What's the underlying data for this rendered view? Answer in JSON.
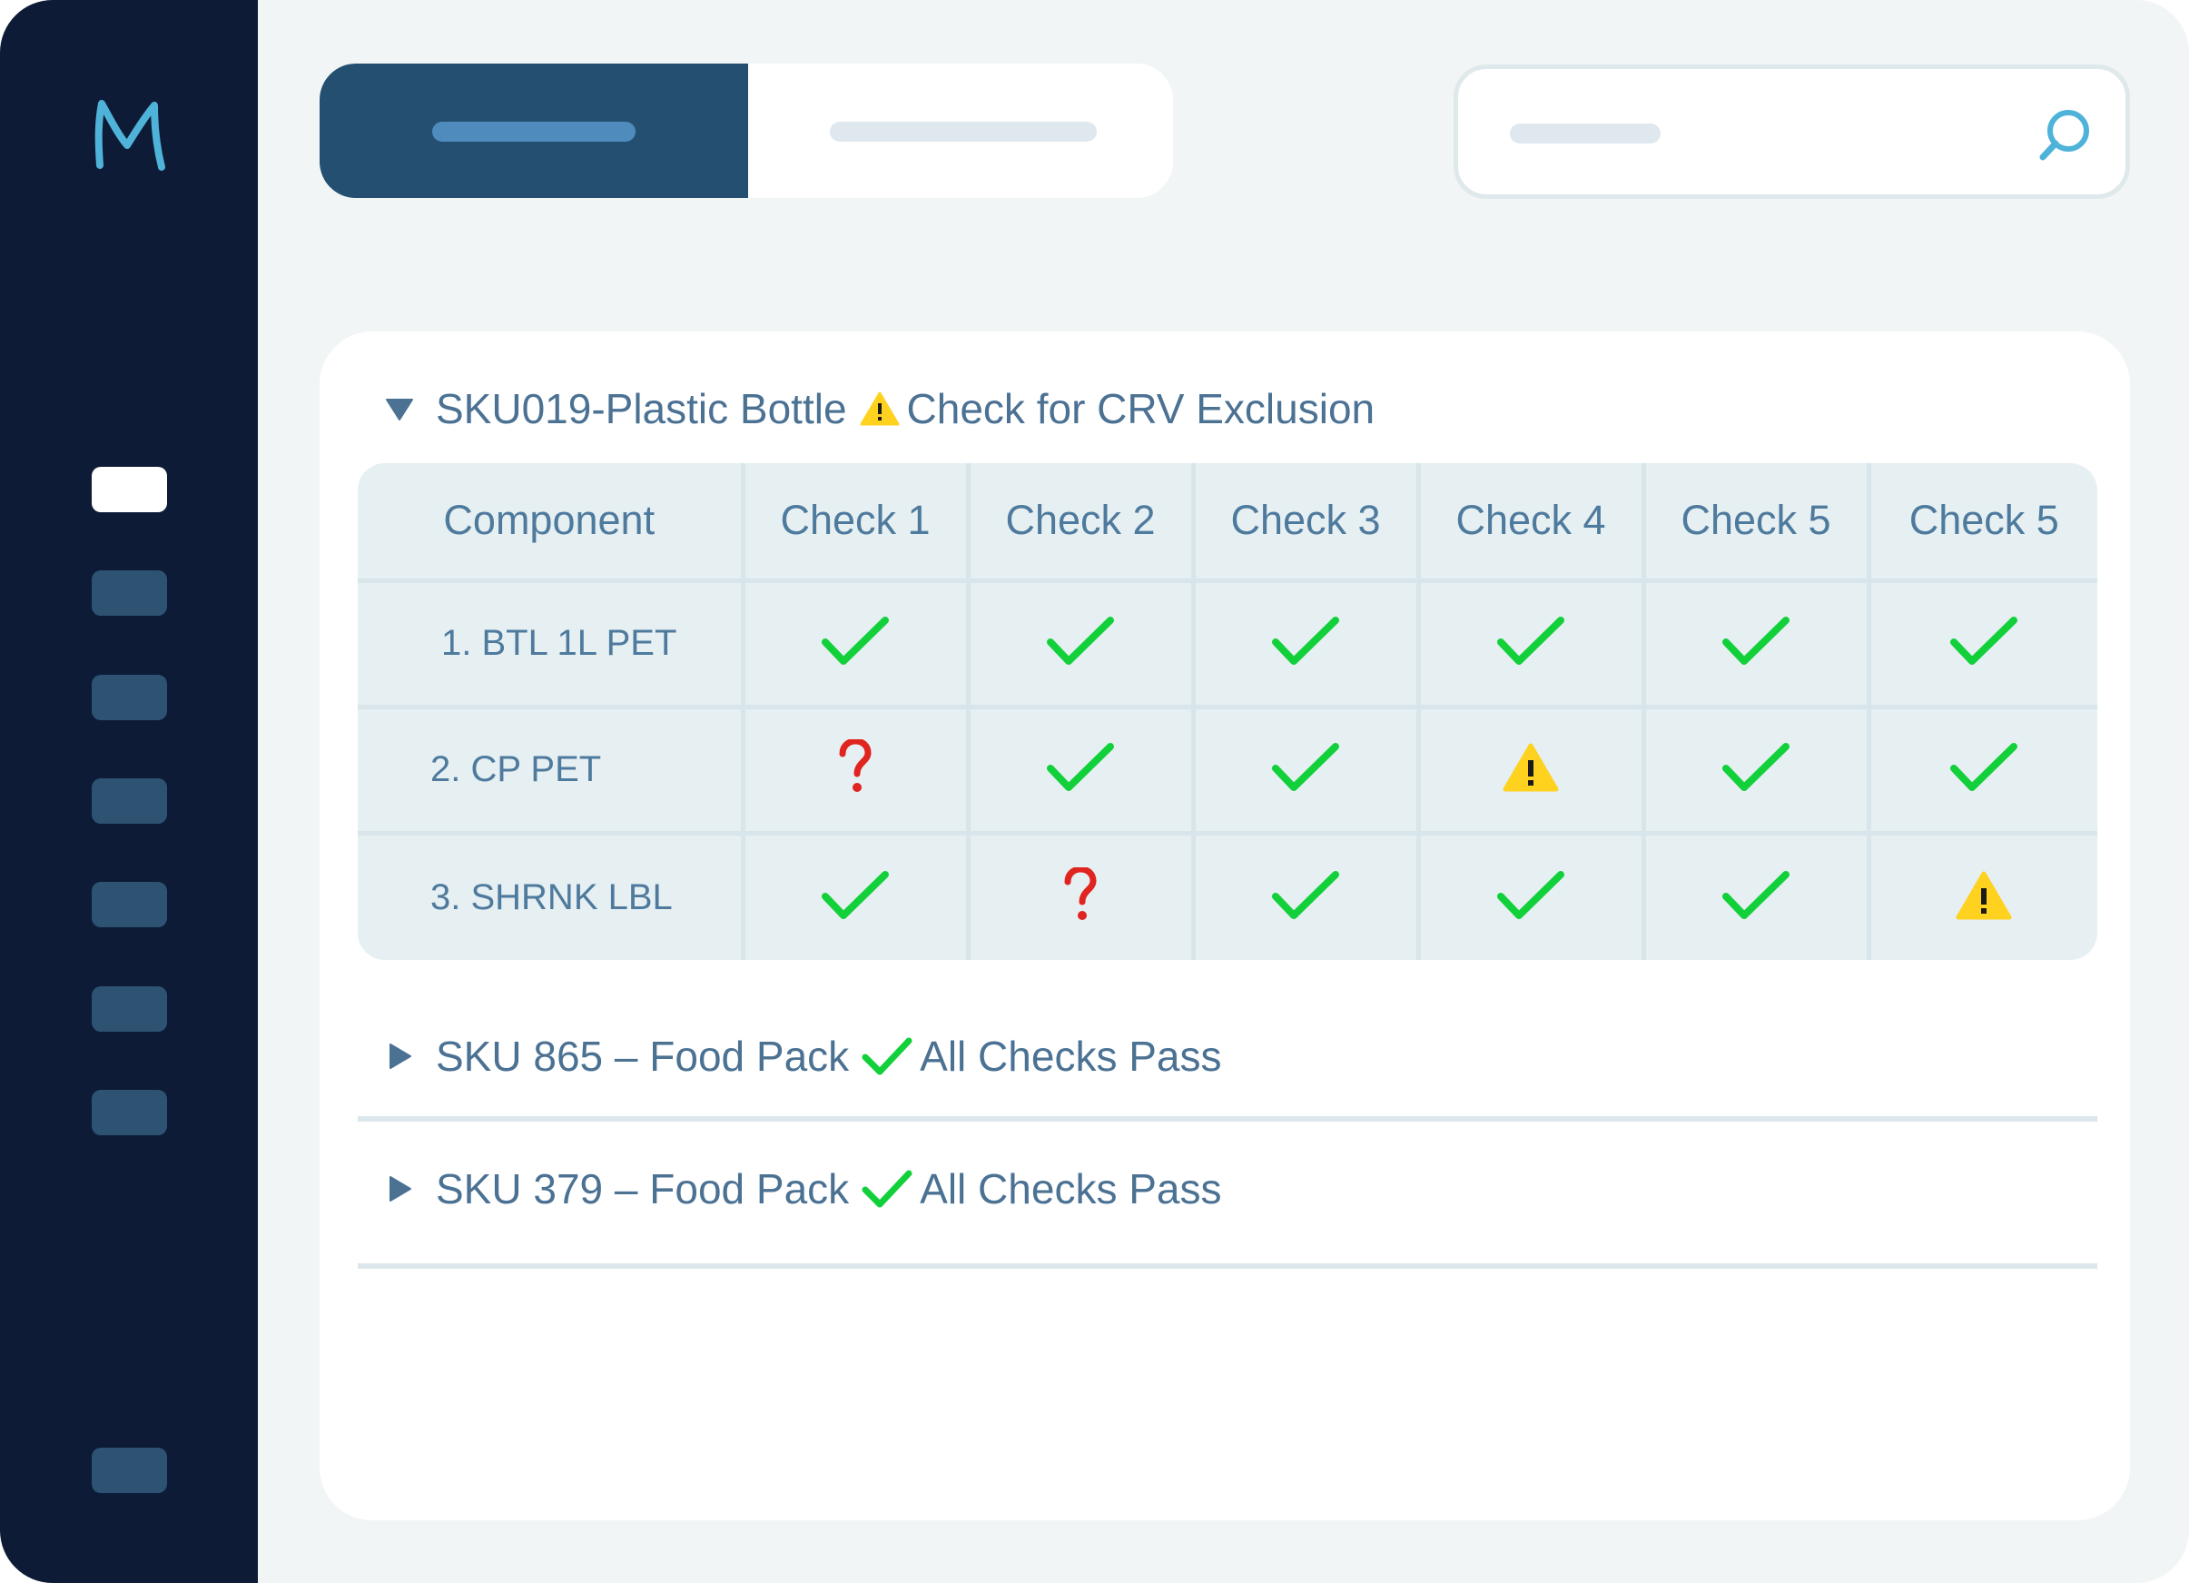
{
  "app": {
    "logo_letter": "M",
    "accent": "#4fb3d9",
    "sidebar_bg": "#0d1b37"
  },
  "sidebar": {
    "items": [
      {
        "name": "nav-1",
        "active": true
      },
      {
        "name": "nav-2",
        "active": false
      },
      {
        "name": "nav-3",
        "active": false
      },
      {
        "name": "nav-4",
        "active": false
      },
      {
        "name": "nav-5",
        "active": false
      },
      {
        "name": "nav-6",
        "active": false
      },
      {
        "name": "nav-7",
        "active": false
      },
      {
        "name": "nav-bottom",
        "active": false
      }
    ]
  },
  "header": {
    "tabs": [
      {
        "label": "",
        "active": true
      },
      {
        "label": "",
        "active": false
      }
    ],
    "search": {
      "placeholder": "",
      "icon": "search-icon"
    }
  },
  "groups": [
    {
      "title": "SKU019-Plastic Bottle",
      "status_icon": "warning-icon",
      "status_text": "Check for CRV Exclusion",
      "expanded": true,
      "table": {
        "columns": [
          "Component",
          "Check 1",
          "Check 2",
          "Check 3",
          "Check 4",
          "Check 5",
          "Check 5"
        ],
        "rows": [
          {
            "component": "1. BTL 1L PET",
            "results": [
              "pass",
              "pass",
              "pass",
              "pass",
              "pass",
              "pass"
            ]
          },
          {
            "component": "2. CP PET",
            "results": [
              "unknown",
              "pass",
              "pass",
              "warning",
              "pass",
              "pass"
            ]
          },
          {
            "component": "3. SHRNK LBL",
            "results": [
              "pass",
              "unknown",
              "pass",
              "pass",
              "pass",
              "warning"
            ]
          }
        ]
      }
    },
    {
      "title": "SKU 865 – Food Pack",
      "status_icon": "check-icon",
      "status_text": "All Checks Pass",
      "expanded": false
    },
    {
      "title": "SKU 379 – Food Pack",
      "status_icon": "check-icon",
      "status_text": "All Checks Pass",
      "expanded": false
    }
  ],
  "status_colors": {
    "pass": "#12d03a",
    "unknown": "#e0241f",
    "warning": "#ffd21f"
  }
}
